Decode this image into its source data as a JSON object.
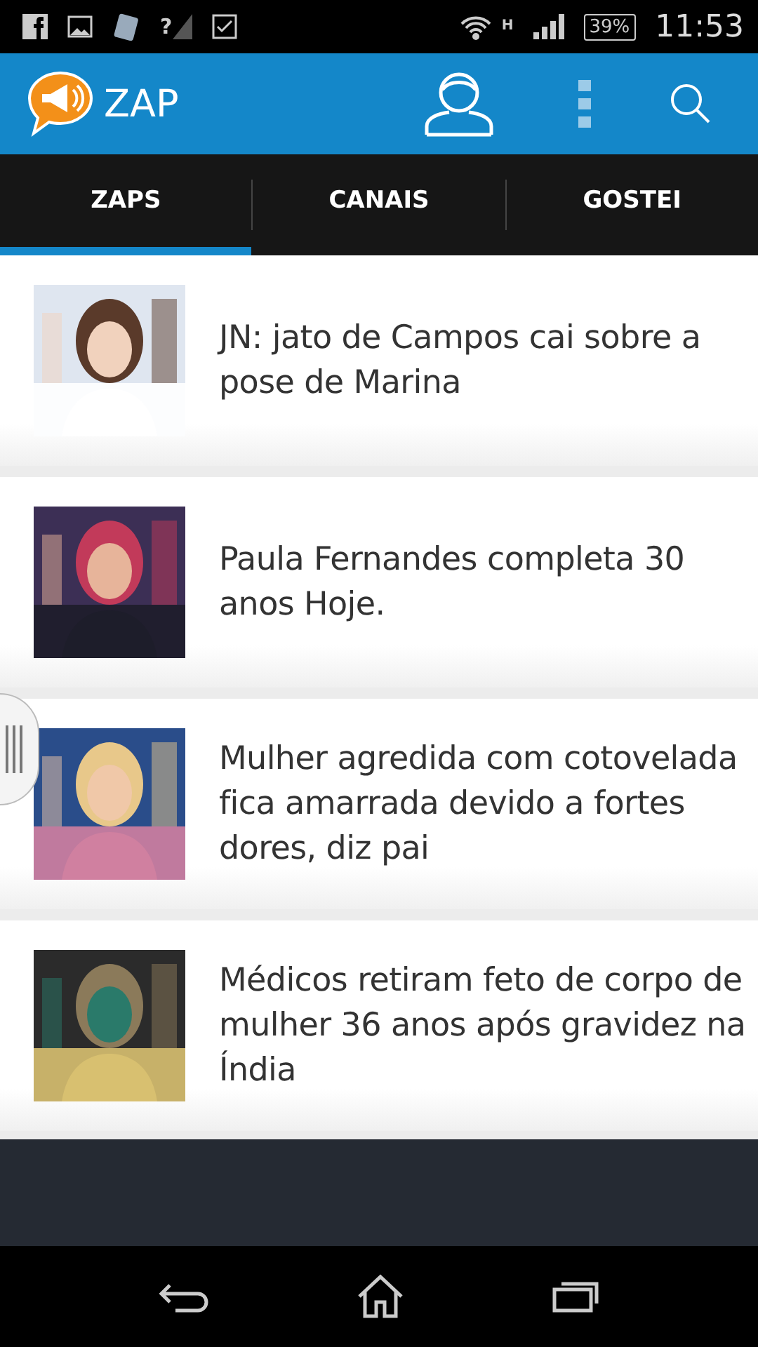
{
  "status_bar": {
    "signal_unknown": "?",
    "network_type": "H",
    "battery": "39%",
    "time": "11:53"
  },
  "app_bar": {
    "title": "ZAP"
  },
  "tabs": [
    {
      "label": "ZAPS",
      "selected": true
    },
    {
      "label": "CANAIS",
      "selected": false
    },
    {
      "label": "GOSTEI",
      "selected": false
    }
  ],
  "news": [
    {
      "headline": "JN: jato de Campos cai sobre a pose de Marina",
      "kind": "picture"
    },
    {
      "headline": "Paula Fernandes completa 30 anos Hoje.",
      "kind": "picture"
    },
    {
      "headline": "Mulher agredida com cotovelada fica amarrada devido a fortes dores, diz pai",
      "kind": "picture"
    },
    {
      "headline": "Médicos retiram feto de corpo de mulher 36 anos após gravidez na Índia",
      "kind": "picture"
    }
  ]
}
